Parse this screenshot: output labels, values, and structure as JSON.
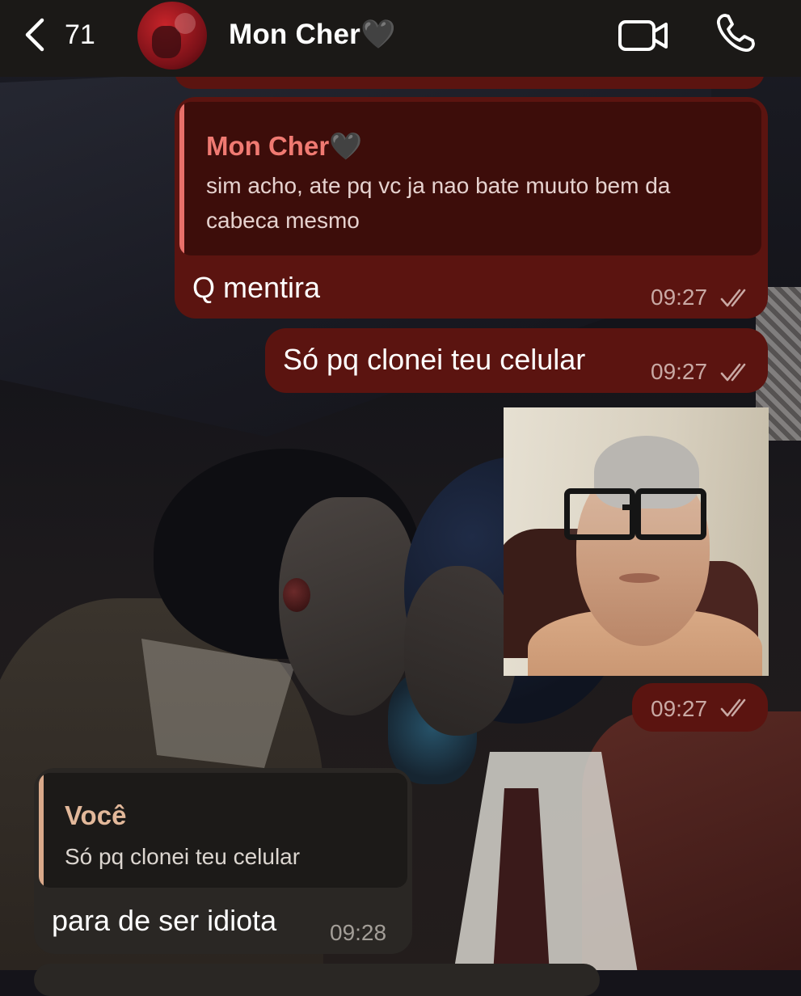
{
  "header": {
    "back_count": "71",
    "chat_title": "Mon Cher🖤"
  },
  "messages": [
    {
      "direction": "outgoing",
      "reply": {
        "name": "Mon Cher🖤",
        "text_line1": "sim acho, ate pq vc ja nao bate muuto bem da",
        "text_line2": "cabeca mesmo"
      },
      "text": "Q mentira",
      "time": "09:27",
      "status": "read"
    },
    {
      "direction": "outgoing",
      "text": "Só pq clonei teu celular",
      "time": "09:27",
      "status": "read"
    },
    {
      "direction": "outgoing",
      "type": "photo",
      "time": "09:27",
      "status": "read"
    },
    {
      "direction": "incoming",
      "reply": {
        "name": "Você",
        "text_line1": "Só pq clonei teu celular"
      },
      "text": "para de ser idiota",
      "time": "09:28"
    }
  ],
  "colors": {
    "outgoing_bubble": "#5b1410",
    "incoming_bubble": "#2a2724",
    "reply_name_outgoing": "#f07a72",
    "reply_name_incoming": "#e2b89a"
  },
  "icons": [
    "chevron-left-icon",
    "video-camera-icon",
    "phone-icon",
    "double-check-icon"
  ]
}
